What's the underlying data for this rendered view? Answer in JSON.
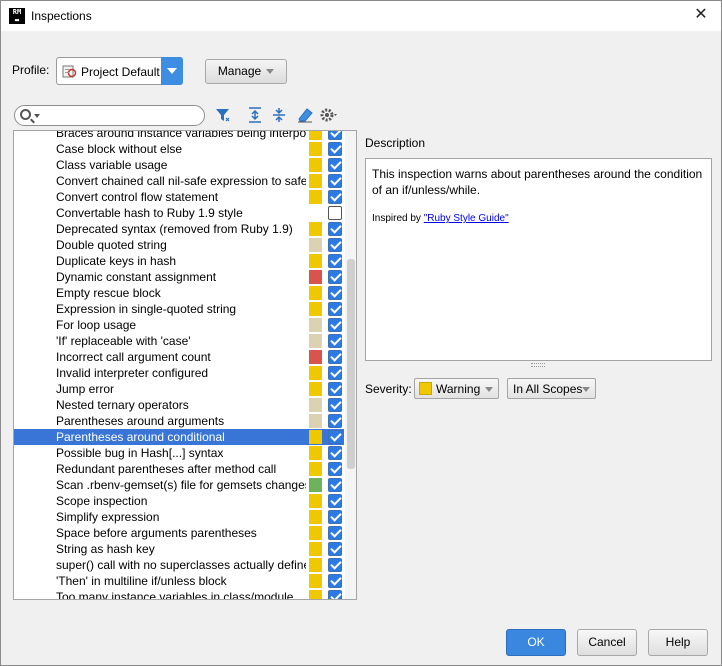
{
  "window": {
    "title": "Inspections",
    "app_icon_text": [
      "RM",
      "▬"
    ]
  },
  "profile": {
    "label": "Profile:",
    "value": "Project Default",
    "manage_label": "Manage"
  },
  "search": {
    "placeholder": ""
  },
  "toolbar": {
    "icons": [
      "filter-icon",
      "expand-all-icon",
      "collapse-all-icon",
      "reset-icon",
      "settings-icon"
    ]
  },
  "colors": {
    "warning": "#f0c800",
    "weak_warning": "#dbd2b3",
    "error": "#d9534f",
    "info_green": "#6eb25c",
    "selection": "#3875d7",
    "accent": "#3d8ee3"
  },
  "inspections": [
    {
      "label": "Braces around instance variables being interpol",
      "severity": "warning",
      "checked": true
    },
    {
      "label": "Case block without else",
      "severity": "warning",
      "checked": true
    },
    {
      "label": "Class variable usage",
      "severity": "warning",
      "checked": true
    },
    {
      "label": "Convert chained call nil-safe expression to safe",
      "severity": "warning",
      "checked": true
    },
    {
      "label": "Convert control flow statement",
      "severity": "warning",
      "checked": true
    },
    {
      "label": "Convertable hash to Ruby 1.9 style",
      "severity": "none",
      "checked": false
    },
    {
      "label": "Deprecated syntax (removed from Ruby 1.9)",
      "severity": "warning",
      "checked": true
    },
    {
      "label": "Double quoted string",
      "severity": "weak_warning",
      "checked": true
    },
    {
      "label": "Duplicate keys in hash",
      "severity": "warning",
      "checked": true
    },
    {
      "label": "Dynamic constant assignment",
      "severity": "error",
      "checked": true
    },
    {
      "label": "Empty rescue block",
      "severity": "warning",
      "checked": true
    },
    {
      "label": "Expression in single-quoted string",
      "severity": "warning",
      "checked": true
    },
    {
      "label": "For loop usage",
      "severity": "weak_warning",
      "checked": true
    },
    {
      "label": "'If' replaceable with 'case'",
      "severity": "weak_warning",
      "checked": true
    },
    {
      "label": "Incorrect call argument count",
      "severity": "error",
      "checked": true
    },
    {
      "label": "Invalid interpreter configured",
      "severity": "warning",
      "checked": true
    },
    {
      "label": "Jump error",
      "severity": "warning",
      "checked": true
    },
    {
      "label": "Nested ternary operators",
      "severity": "weak_warning",
      "checked": true
    },
    {
      "label": "Parentheses around arguments",
      "severity": "weak_warning",
      "checked": true
    },
    {
      "label": "Parentheses around conditional",
      "severity": "warning",
      "checked": true,
      "selected": true
    },
    {
      "label": "Possible bug in Hash[...] syntax",
      "severity": "warning",
      "checked": true
    },
    {
      "label": "Redundant parentheses after method call",
      "severity": "warning",
      "checked": true
    },
    {
      "label": "Scan .rbenv-gemset(s) file for gemsets changes",
      "severity": "info_green",
      "checked": true
    },
    {
      "label": "Scope inspection",
      "severity": "warning",
      "checked": true
    },
    {
      "label": "Simplify expression",
      "severity": "warning",
      "checked": true
    },
    {
      "label": "Space before arguments parentheses",
      "severity": "warning",
      "checked": true
    },
    {
      "label": "String as hash key",
      "severity": "warning",
      "checked": true
    },
    {
      "label": "super() call with no superclasses actually define",
      "severity": "warning",
      "checked": true
    },
    {
      "label": "'Then' in multiline if/unless block",
      "severity": "warning",
      "checked": true
    },
    {
      "label": "Too many instance variables in class/module",
      "severity": "warning",
      "checked": true
    }
  ],
  "description": {
    "label": "Description",
    "text": "This inspection warns about parentheses around the condition of an if/unless/while.",
    "inspired_prefix": "Inspired by ",
    "inspired_link": "\"Ruby Style Guide\""
  },
  "severity": {
    "label": "Severity:",
    "value": "Warning",
    "scope": "In All Scopes"
  },
  "buttons": {
    "ok": "OK",
    "cancel": "Cancel",
    "help": "Help"
  }
}
